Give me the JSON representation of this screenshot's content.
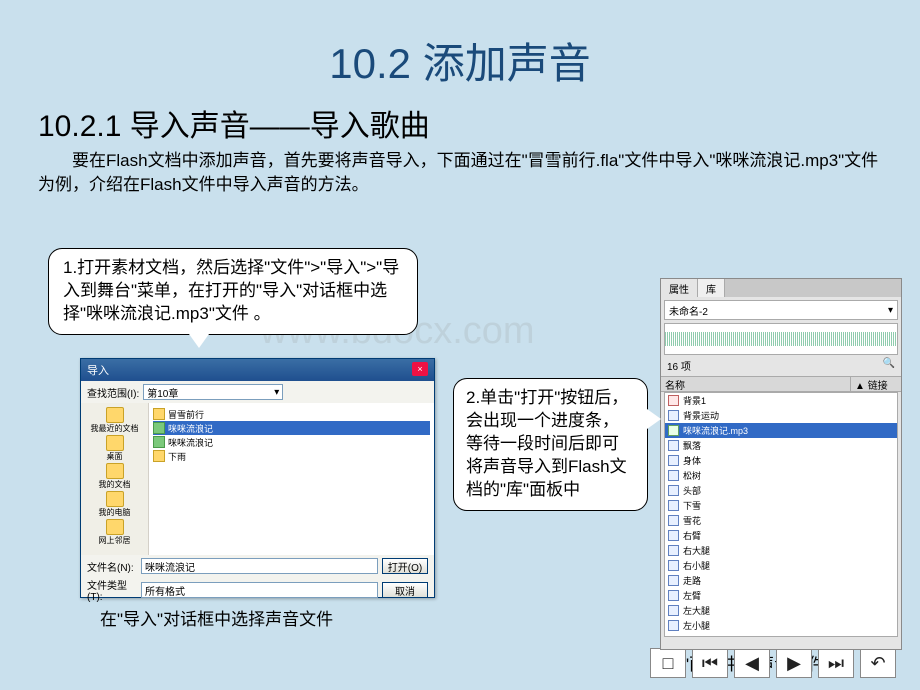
{
  "watermark": "www.bdocx.com",
  "title": "10.2  添加声音",
  "subtitle": "10.2.1  导入声音——导入歌曲",
  "intro": "要在Flash文档中添加声音，首先要将声音导入，下面通过在\"冒雪前行.fla\"文件中导入\"咪咪流浪记.mp3\"文件为例，介绍在Flash文件中导入声音的方法。",
  "callout1": "1.打开素材文档，然后选择\"文件\">\"导入\">\"导入到舞台\"菜单，在打开的\"导入\"对话框中选择\"咪咪流浪记.mp3\"文件 。",
  "callout2": "2.单击\"打开\"按钮后，会出现一个进度条，等待一段时间后即可将声音导入到Flash文档的\"库\"面板中",
  "importDialog": {
    "title": "导入",
    "lookIn": "查找范围(I):",
    "folder": "第10章",
    "sidebarItems": [
      "我最近的文档",
      "桌面",
      "我的文档",
      "我的电脑",
      "网上邻居"
    ],
    "files": [
      {
        "name": "冒雪前行",
        "type": "folder"
      },
      {
        "name": "咪咪流浪记",
        "type": "mp3",
        "selected": true
      },
      {
        "name": "咪咪流浪记",
        "type": "mp3"
      },
      {
        "name": "下雨",
        "type": "folder"
      }
    ],
    "fileNameLabel": "文件名(N):",
    "fileNameValue": "咪咪流浪记",
    "fileTypeLabel": "文件类型(T):",
    "fileTypeValue": "所有格式",
    "openBtn": "打开(O)",
    "cancelBtn": "取消"
  },
  "captionLeft": "在\"导入\"对话框中选择声音文件",
  "library": {
    "tab1": "属性",
    "tab2": "库",
    "doc": "未命名-2",
    "countText": "16 项",
    "colName": "名称",
    "colLink": "链接",
    "items": [
      {
        "name": "背景1",
        "type": "gfx"
      },
      {
        "name": "背景运动",
        "type": "mc"
      },
      {
        "name": "咪咪流浪记.mp3",
        "type": "snd",
        "selected": true
      },
      {
        "name": "飘落",
        "type": "mc"
      },
      {
        "name": "身体",
        "type": "mc"
      },
      {
        "name": "松树",
        "type": "mc"
      },
      {
        "name": "头部",
        "type": "mc"
      },
      {
        "name": "下雪",
        "type": "mc"
      },
      {
        "name": "雪花",
        "type": "mc"
      },
      {
        "name": "右臂",
        "type": "mc"
      },
      {
        "name": "右大腿",
        "type": "mc"
      },
      {
        "name": "右小腿",
        "type": "mc"
      },
      {
        "name": "走路",
        "type": "mc"
      },
      {
        "name": "左臂",
        "type": "mc"
      },
      {
        "name": "左大腿",
        "type": "mc"
      },
      {
        "name": "左小腿",
        "type": "mc"
      }
    ]
  },
  "captionRight": "\"库\"面板中的声音文件",
  "nav": {
    "stop": "□",
    "first": "⏮",
    "prev": "◀",
    "next": "▶",
    "last": "⏭",
    "return": "↶"
  }
}
